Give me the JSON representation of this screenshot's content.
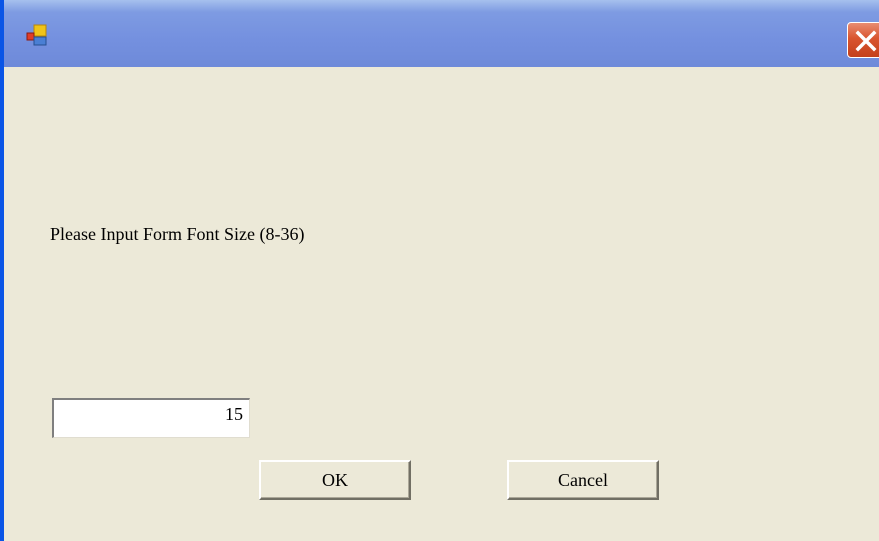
{
  "dialog": {
    "title": "",
    "prompt": "Please Input Form Font Size (8-36)",
    "font_size_value": "15",
    "ok_label": "OK",
    "cancel_label": "Cancel"
  },
  "icons": {
    "app": "application-window-icon",
    "close": "close-icon"
  },
  "colors": {
    "titlebar": "#7e9be2",
    "window_background": "#ece9d8",
    "close_button": "#d9552f",
    "window_border": "#0a55e6"
  }
}
